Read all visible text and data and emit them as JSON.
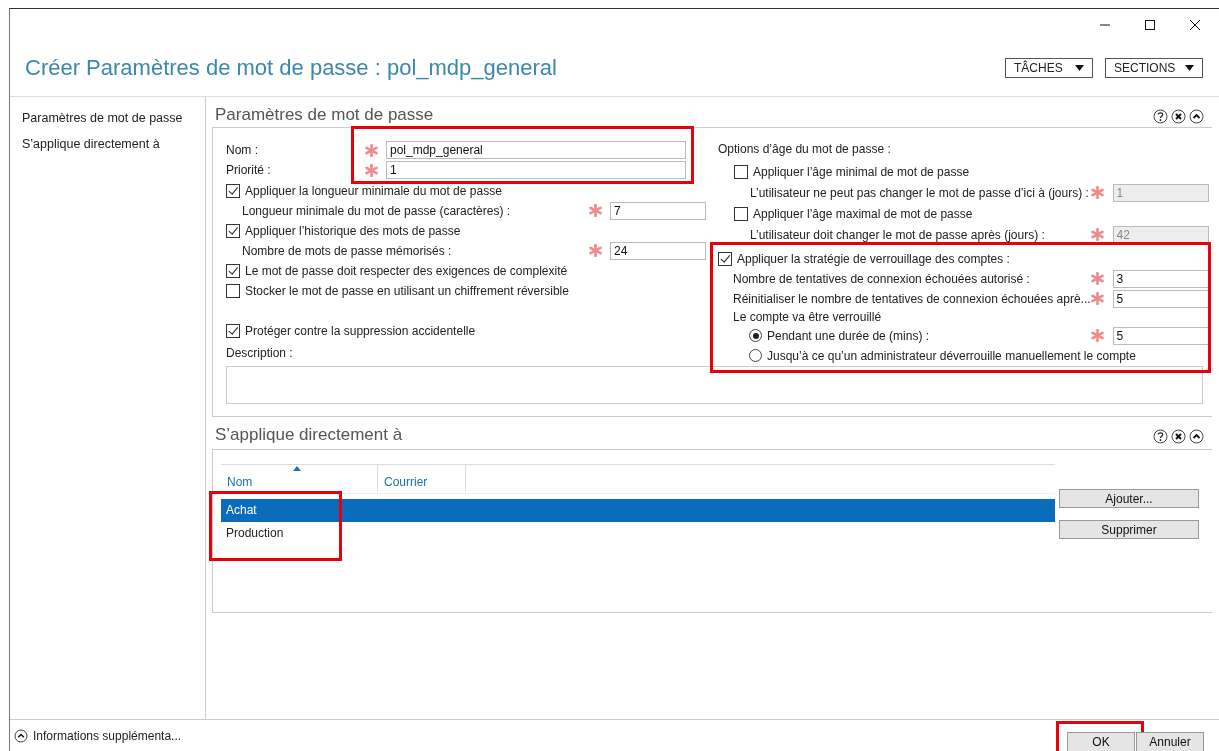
{
  "window": {
    "title": "Créer Paramètres de mot de passe : pol_mdp_general"
  },
  "header_buttons": [
    {
      "label": "TÂCHES"
    },
    {
      "label": "SECTIONS"
    }
  ],
  "nav": {
    "items": [
      {
        "label": "Paramètres de mot de passe"
      },
      {
        "label": "S’applique directement à"
      }
    ]
  },
  "password_section": {
    "title": "Paramètres de mot de passe",
    "identity": {
      "highlighted": true,
      "fields": [
        {
          "label": "Nom :",
          "value": "pol_mdp_general",
          "required": true
        },
        {
          "label": "Priorité :",
          "value": "1",
          "required": true
        }
      ]
    },
    "left": [
      {
        "kind": "checkbox",
        "label": "Appliquer la longueur minimale du mot de passe",
        "checked": true
      },
      {
        "kind": "subfield",
        "label": "Longueur minimale du mot de passe (caractères) :",
        "value": "7",
        "required": true,
        "disabled": false
      },
      {
        "kind": "checkbox",
        "label": "Appliquer l’historique des mots de passe",
        "checked": true
      },
      {
        "kind": "subfield",
        "label": "Nombre de mots de passe mémorisés :",
        "value": "24",
        "required": true,
        "disabled": false
      },
      {
        "kind": "checkbox",
        "label": "Le mot de passe doit respecter des exigences de complexité",
        "checked": true
      },
      {
        "kind": "checkbox",
        "label": "Stocker le mot de passe en utilisant un chiffrement réversible",
        "checked": false
      },
      {
        "kind": "spacer"
      },
      {
        "kind": "checkbox",
        "label": "Protéger contre la suppression accidentelle",
        "checked": true
      }
    ],
    "description": {
      "label": "Description :"
    },
    "age_title": "Options d’âge du mot de passe :",
    "age": [
      {
        "kind": "checkbox",
        "label": "Appliquer l’âge minimal de mot de passe",
        "checked": false
      },
      {
        "kind": "subfield",
        "label": "L’utilisateur ne peut pas changer le mot de passe d’ici à (jours) :",
        "value": "1",
        "required": true,
        "disabled": true
      },
      {
        "kind": "checkbox",
        "label": "Appliquer l’âge maximal de mot de passe",
        "checked": false
      },
      {
        "kind": "subfield",
        "label": "L’utilisateur doit changer le mot de passe après (jours) :",
        "value": "42",
        "required": true,
        "disabled": true
      }
    ],
    "lockout": {
      "highlighted": true,
      "label": "Appliquer la stratégie de verrouillage des comptes :",
      "checked": true,
      "fields": [
        {
          "label": "Nombre de tentatives de connexion échouées autorisé :",
          "value": "3",
          "required": true
        },
        {
          "label": "Réinitialiser le nombre de tentatives de connexion échouées aprè...",
          "value": "5",
          "required": true
        }
      ],
      "lock_label": "Le compte va être verrouillé",
      "options": [
        {
          "label": "Pendant une durée de (mins) :",
          "selected": true,
          "value": "5",
          "required": true
        },
        {
          "label": "Jusqu’à ce qu’un administrateur déverrouille manuellement le compte",
          "selected": false
        }
      ]
    }
  },
  "members_section": {
    "title": "S’applique directement à",
    "columns": [
      {
        "label": "Nom",
        "sorted": true
      },
      {
        "label": "Courrier",
        "sorted": false
      }
    ],
    "rows_highlighted": true,
    "rows": [
      {
        "name": "Achat",
        "selected": true
      },
      {
        "name": "Production",
        "selected": false
      }
    ],
    "buttons": [
      {
        "label": "Ajouter..."
      },
      {
        "label": "Supprimer"
      }
    ]
  },
  "footer": {
    "more_info": "Informations supplémenta...",
    "buttons": [
      {
        "label": "OK",
        "highlighted": true
      },
      {
        "label": "Annuler",
        "highlighted": false
      }
    ]
  }
}
